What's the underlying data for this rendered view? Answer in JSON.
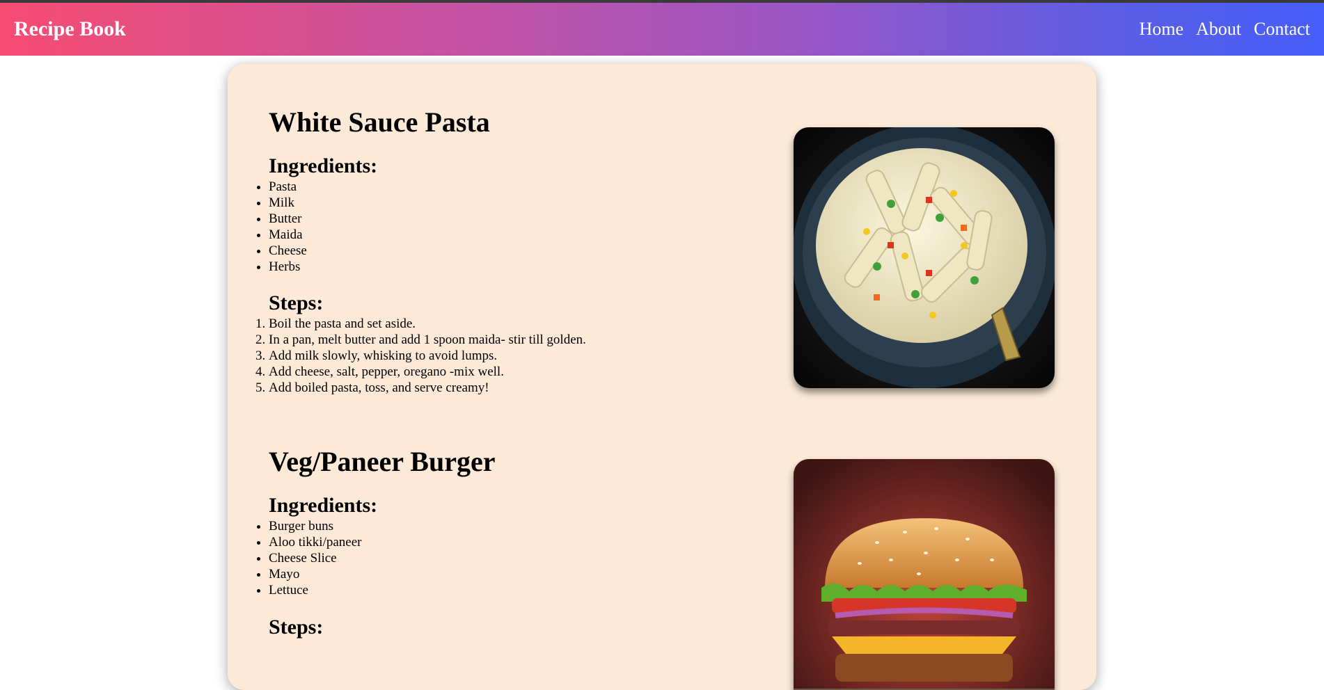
{
  "header": {
    "brand": "Recipe Book",
    "nav": [
      "Home",
      "About",
      "Contact"
    ]
  },
  "recipes": [
    {
      "title": "White Sauce Pasta",
      "ingredients_heading": "Ingredients:",
      "ingredients": [
        "Pasta",
        "Milk",
        "Butter",
        "Maida",
        "Cheese",
        "Herbs"
      ],
      "steps_heading": "Steps:",
      "steps": [
        "Boil the pasta and set aside.",
        "In a pan, melt butter and add 1 spoon maida- stir till golden.",
        "Add milk slowly, whisking to avoid lumps.",
        "Add cheese, salt, pepper, oregano -mix well.",
        "Add boiled pasta, toss, and serve creamy!"
      ]
    },
    {
      "title": "Veg/Paneer Burger",
      "ingredients_heading": "Ingredients:",
      "ingredients": [
        "Burger buns",
        "Aloo tikki/paneer",
        "Cheese Slice",
        "Mayo",
        "Lettuce"
      ],
      "steps_heading": "Steps:"
    }
  ],
  "colors": {
    "card_bg": "#fce9d8",
    "header_gradient_start": "#f64c72",
    "header_gradient_end": "#475ef9"
  }
}
